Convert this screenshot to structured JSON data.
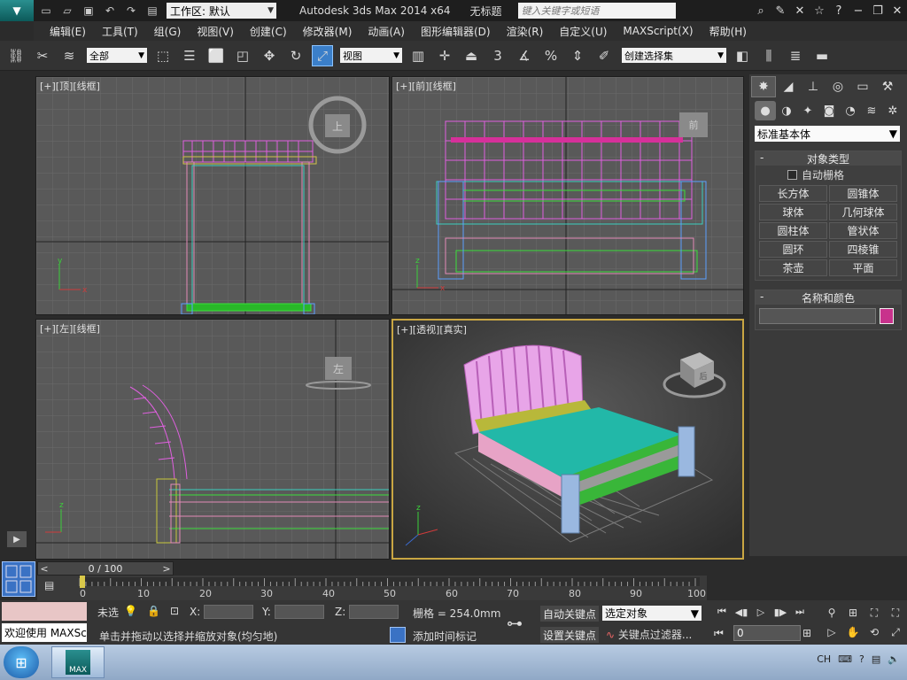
{
  "titlebar": {
    "workspace": "工作区: 默认",
    "app_title": "Autodesk 3ds Max  2014 x64",
    "doc_title": "无标题",
    "search_placeholder": "键入关键字或短语"
  },
  "menu": [
    "编辑(E)",
    "工具(T)",
    "组(G)",
    "视图(V)",
    "创建(C)",
    "修改器(M)",
    "动画(A)",
    "图形编辑器(D)",
    "渲染(R)",
    "自定义(U)",
    "MAXScript(X)",
    "帮助(H)"
  ],
  "toolbar": {
    "filter": "全部",
    "ref_coord": "视图",
    "snap_label": "3",
    "named_selection": "创建选择集"
  },
  "viewports": {
    "top": "[+][顶][线框]",
    "front": "[+][前][线框]",
    "left": "[+][左][线框]",
    "persp": "[+][透视][真实]",
    "cube_top": "上",
    "cube_front": "前",
    "cube_left": "左",
    "cube_persp": "后"
  },
  "command_panel": {
    "category": "标准基本体",
    "object_type_title": "对象类型",
    "autogrid": "自动栅格",
    "objects": [
      "长方体",
      "圆锥体",
      "球体",
      "几何球体",
      "圆柱体",
      "管状体",
      "圆环",
      "四棱锥",
      "茶壶",
      "平面"
    ],
    "name_color_title": "名称和颜色",
    "object_color": "#c8328c"
  },
  "timeline": {
    "slider": "0 / 100",
    "ticks": [
      "0",
      "10",
      "20",
      "30",
      "40",
      "50",
      "60",
      "70",
      "80",
      "90",
      "100"
    ]
  },
  "status": {
    "maxscript": "欢迎使用 MAXScri",
    "selection": "未选",
    "x_label": "X:",
    "y_label": "Y:",
    "z_label": "Z:",
    "grid": "栅格 = 254.0mm",
    "prompt": "单击并拖动以选择并缩放对象(均匀地)",
    "add_time_tag": "添加时间标记",
    "auto_key": "自动关键点",
    "set_key": "设置关键点",
    "key_mode": "选定对象",
    "key_filters": "关键点过滤器...",
    "frame": "0"
  },
  "taskbar": {
    "app_label": "MAX",
    "lang": "CH"
  }
}
